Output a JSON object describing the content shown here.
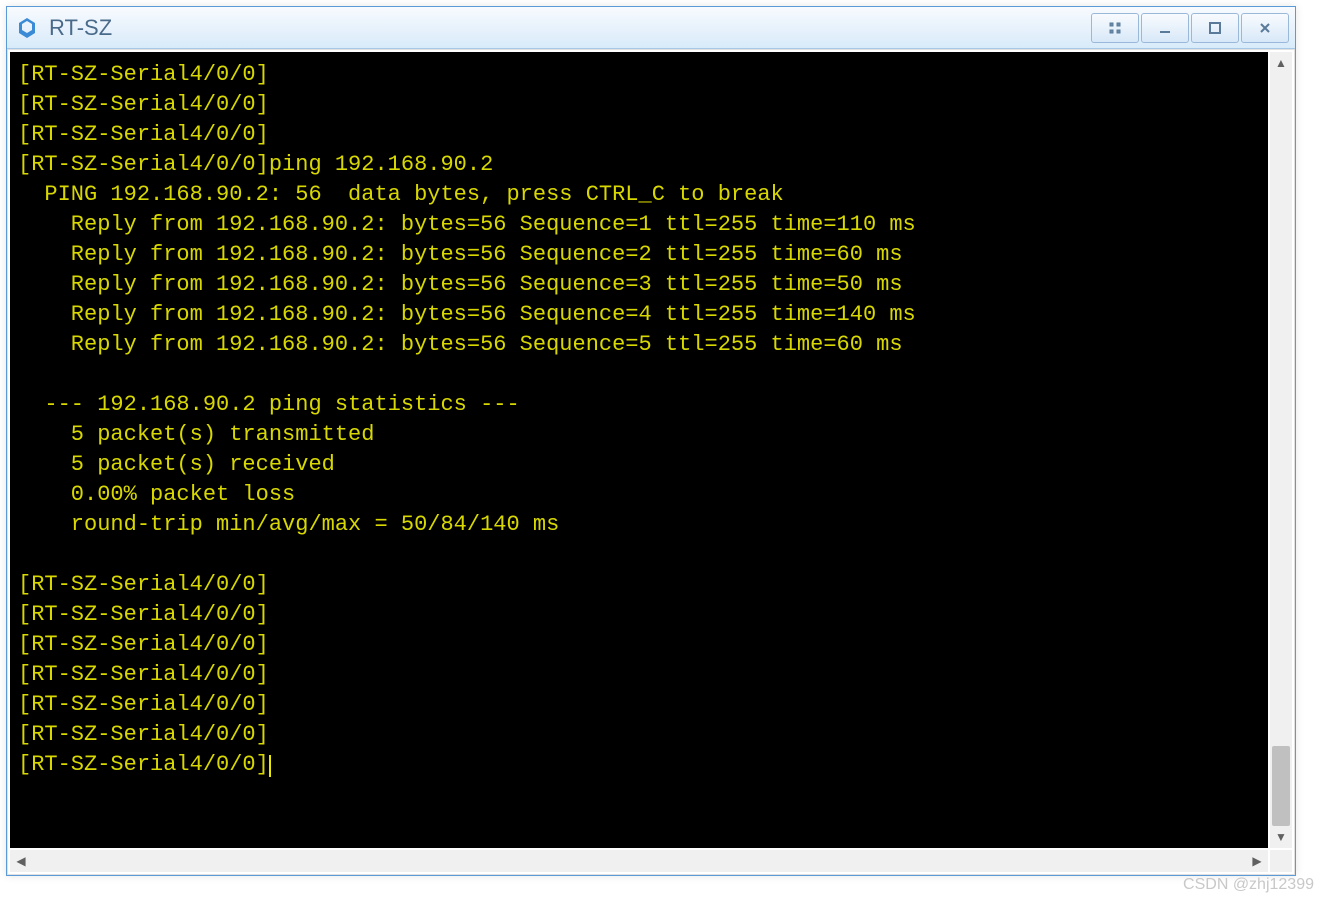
{
  "window": {
    "title": "RT-SZ"
  },
  "terminal": {
    "lines": [
      "[RT-SZ-Serial4/0/0]",
      "[RT-SZ-Serial4/0/0]",
      "[RT-SZ-Serial4/0/0]",
      "[RT-SZ-Serial4/0/0]ping 192.168.90.2",
      "  PING 192.168.90.2: 56  data bytes, press CTRL_C to break",
      "    Reply from 192.168.90.2: bytes=56 Sequence=1 ttl=255 time=110 ms",
      "    Reply from 192.168.90.2: bytes=56 Sequence=2 ttl=255 time=60 ms",
      "    Reply from 192.168.90.2: bytes=56 Sequence=3 ttl=255 time=50 ms",
      "    Reply from 192.168.90.2: bytes=56 Sequence=4 ttl=255 time=140 ms",
      "    Reply from 192.168.90.2: bytes=56 Sequence=5 ttl=255 time=60 ms",
      "",
      "  --- 192.168.90.2 ping statistics ---",
      "    5 packet(s) transmitted",
      "    5 packet(s) received",
      "    0.00% packet loss",
      "    round-trip min/avg/max = 50/84/140 ms",
      "",
      "[RT-SZ-Serial4/0/0]",
      "[RT-SZ-Serial4/0/0]",
      "[RT-SZ-Serial4/0/0]",
      "[RT-SZ-Serial4/0/0]",
      "[RT-SZ-Serial4/0/0]",
      "[RT-SZ-Serial4/0/0]",
      "[RT-SZ-Serial4/0/0]"
    ],
    "ping": {
      "target": "192.168.90.2",
      "data_bytes": 56,
      "replies": [
        {
          "sequence": 1,
          "bytes": 56,
          "ttl": 255,
          "time_ms": 110
        },
        {
          "sequence": 2,
          "bytes": 56,
          "ttl": 255,
          "time_ms": 60
        },
        {
          "sequence": 3,
          "bytes": 56,
          "ttl": 255,
          "time_ms": 50
        },
        {
          "sequence": 4,
          "bytes": 56,
          "ttl": 255,
          "time_ms": 140
        },
        {
          "sequence": 5,
          "bytes": 56,
          "ttl": 255,
          "time_ms": 60
        }
      ],
      "statistics": {
        "transmitted": 5,
        "received": 5,
        "packet_loss_percent": 0.0,
        "rtt_min_ms": 50,
        "rtt_avg_ms": 84,
        "rtt_max_ms": 140
      }
    },
    "prompt": "[RT-SZ-Serial4/0/0]"
  },
  "watermark": "CSDN @zhj12399"
}
